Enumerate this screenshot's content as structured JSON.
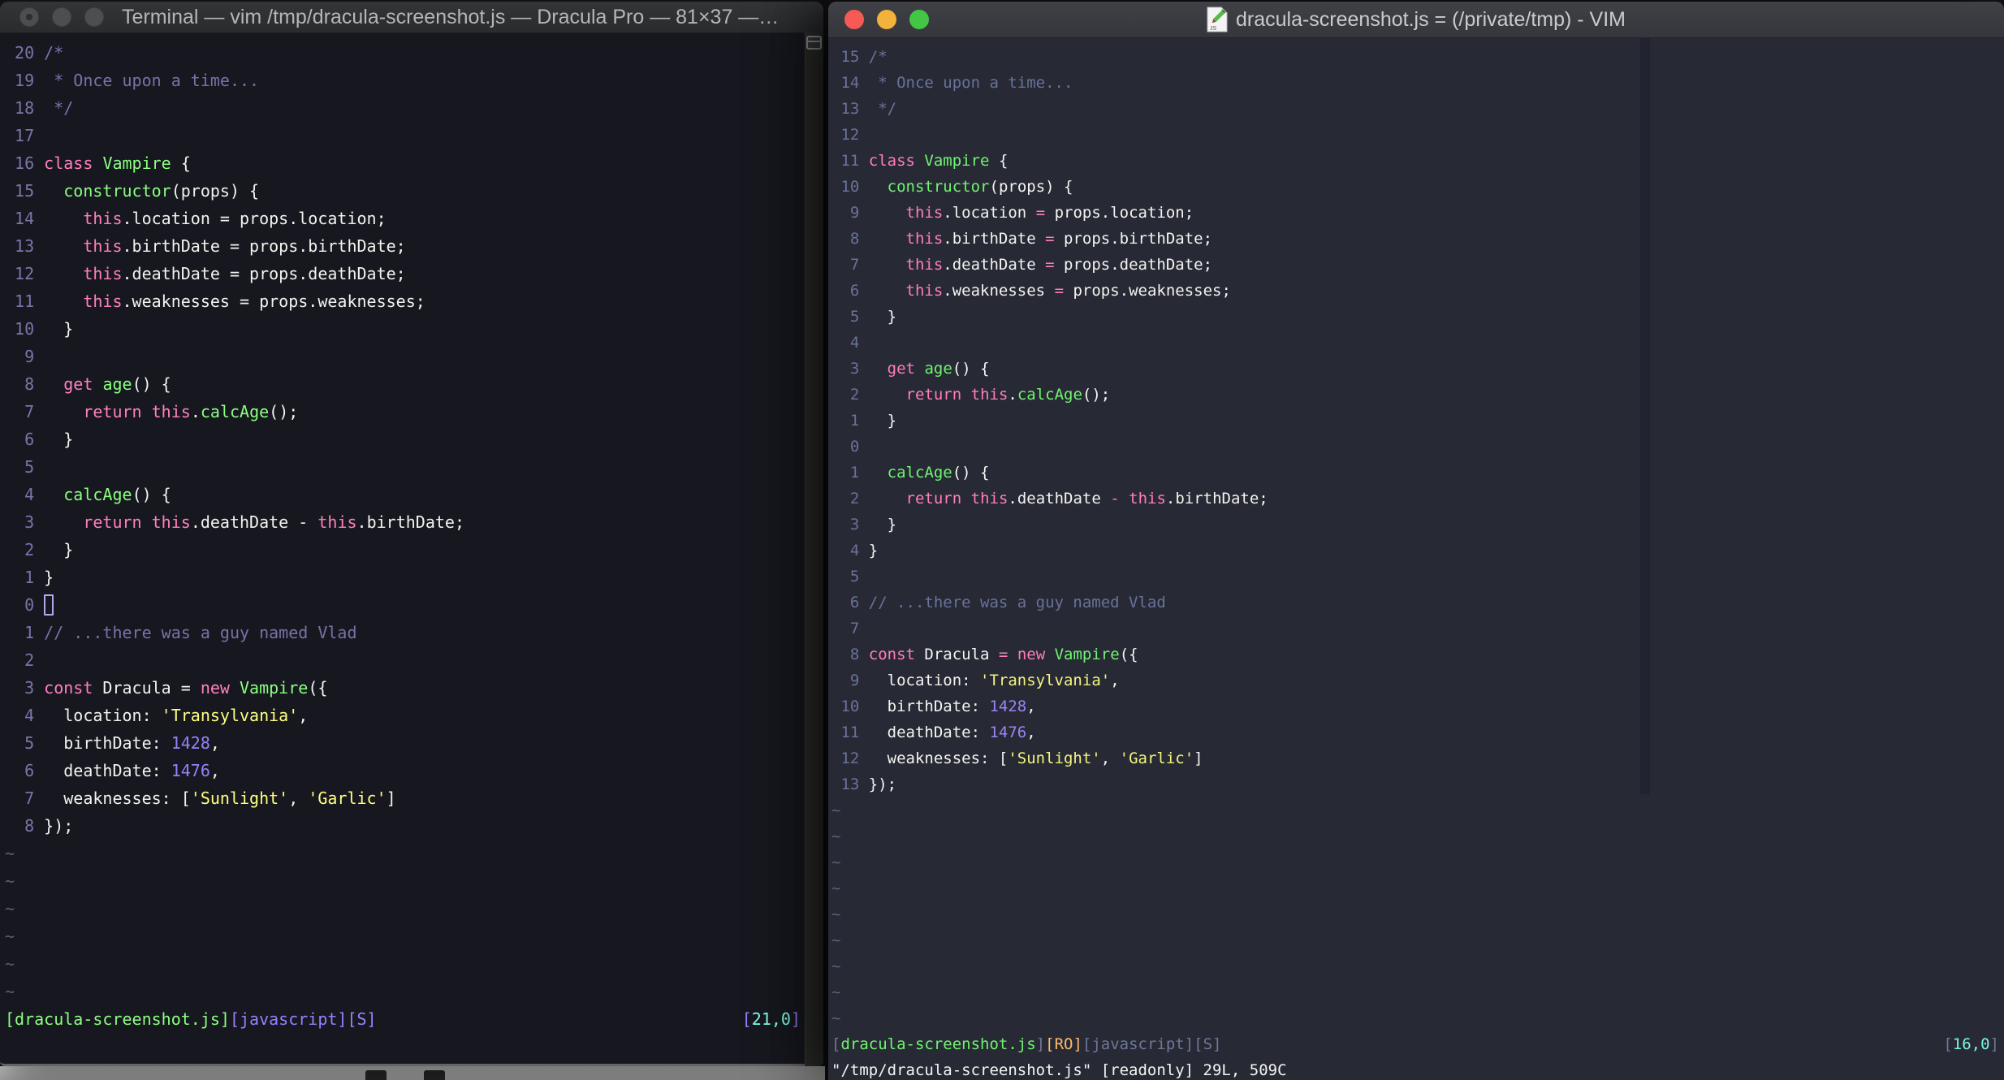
{
  "left_window": {
    "title": "Terminal — vim /tmp/dracula-screenshot.js — Dracula Pro — 81×37 —…",
    "pal": {
      "fg": "#f2f2ef",
      "kw": "#ff80bf",
      "fn": "#8aff80",
      "st": "#ffff80",
      "nu": "#9580ff",
      "cm": "#7970a9",
      "ln": "#7b74ab",
      "ti": "#5a5f6e",
      "cy": "#80ffea",
      "or": "#ffb86c",
      "sb": "#9580ff"
    },
    "lines": [
      {
        "g": " 20",
        "seg": [
          [
            "cm",
            "/*"
          ]
        ]
      },
      {
        "g": " 19",
        "seg": [
          [
            "cm",
            " * Once upon a time..."
          ]
        ]
      },
      {
        "g": " 18",
        "seg": [
          [
            "cm",
            " */"
          ]
        ]
      },
      {
        "g": " 17",
        "seg": []
      },
      {
        "g": " 16",
        "seg": [
          [
            "kw",
            "class"
          ],
          [
            "fg",
            " "
          ],
          [
            "fn",
            "Vampire"
          ],
          [
            "fg",
            " {"
          ]
        ]
      },
      {
        "g": " 15",
        "seg": [
          [
            "fg",
            "  "
          ],
          [
            "fn",
            "constructor"
          ],
          [
            "fg",
            "(props) {"
          ]
        ]
      },
      {
        "g": " 14",
        "seg": [
          [
            "fg",
            "    "
          ],
          [
            "kw",
            "this"
          ],
          [
            "fg",
            ".location = props.location;"
          ]
        ]
      },
      {
        "g": " 13",
        "seg": [
          [
            "fg",
            "    "
          ],
          [
            "kw",
            "this"
          ],
          [
            "fg",
            ".birthDate = props.birthDate;"
          ]
        ]
      },
      {
        "g": " 12",
        "seg": [
          [
            "fg",
            "    "
          ],
          [
            "kw",
            "this"
          ],
          [
            "fg",
            ".deathDate = props.deathDate;"
          ]
        ]
      },
      {
        "g": " 11",
        "seg": [
          [
            "fg",
            "    "
          ],
          [
            "kw",
            "this"
          ],
          [
            "fg",
            ".weaknesses = props.weaknesses;"
          ]
        ]
      },
      {
        "g": " 10",
        "seg": [
          [
            "fg",
            "  }"
          ]
        ]
      },
      {
        "g": "  9",
        "seg": []
      },
      {
        "g": "  8",
        "seg": [
          [
            "fg",
            "  "
          ],
          [
            "kw",
            "get"
          ],
          [
            "fg",
            " "
          ],
          [
            "fn",
            "age"
          ],
          [
            "fg",
            "() {"
          ]
        ]
      },
      {
        "g": "  7",
        "seg": [
          [
            "fg",
            "    "
          ],
          [
            "kw",
            "return"
          ],
          [
            "fg",
            " "
          ],
          [
            "kw",
            "this"
          ],
          [
            "fg",
            "."
          ],
          [
            "fn",
            "calcAge"
          ],
          [
            "fg",
            "();"
          ]
        ]
      },
      {
        "g": "  6",
        "seg": [
          [
            "fg",
            "  }"
          ]
        ]
      },
      {
        "g": "  5",
        "seg": []
      },
      {
        "g": "  4",
        "seg": [
          [
            "fg",
            "  "
          ],
          [
            "fn",
            "calcAge"
          ],
          [
            "fg",
            "() {"
          ]
        ]
      },
      {
        "g": "  3",
        "seg": [
          [
            "fg",
            "    "
          ],
          [
            "kw",
            "return"
          ],
          [
            "fg",
            " "
          ],
          [
            "kw",
            "this"
          ],
          [
            "fg",
            ".deathDate - "
          ],
          [
            "kw",
            "this"
          ],
          [
            "fg",
            ".birthDate;"
          ]
        ]
      },
      {
        "g": "  2",
        "seg": [
          [
            "fg",
            "  }"
          ]
        ]
      },
      {
        "g": "  1",
        "seg": [
          [
            "fg",
            "}"
          ]
        ]
      },
      {
        "g": "  0",
        "seg": [
          [
            "cur",
            ""
          ]
        ]
      },
      {
        "g": "  1",
        "seg": [
          [
            "cm",
            "// ...there was a guy named Vlad"
          ]
        ]
      },
      {
        "g": "  2",
        "seg": []
      },
      {
        "g": "  3",
        "seg": [
          [
            "kw",
            "const"
          ],
          [
            "fg",
            " Dracula = "
          ],
          [
            "kw",
            "new"
          ],
          [
            "fg",
            " "
          ],
          [
            "fn",
            "Vampire"
          ],
          [
            "fg",
            "({"
          ]
        ]
      },
      {
        "g": "  4",
        "seg": [
          [
            "fg",
            "  location: "
          ],
          [
            "st",
            "'Transylvania'"
          ],
          [
            "fg",
            ","
          ]
        ]
      },
      {
        "g": "  5",
        "seg": [
          [
            "fg",
            "  birthDate: "
          ],
          [
            "nu",
            "1428"
          ],
          [
            "fg",
            ","
          ]
        ]
      },
      {
        "g": "  6",
        "seg": [
          [
            "fg",
            "  deathDate: "
          ],
          [
            "nu",
            "1476"
          ],
          [
            "fg",
            ","
          ]
        ]
      },
      {
        "g": "  7",
        "seg": [
          [
            "fg",
            "  weaknesses: ["
          ],
          [
            "st",
            "'Sunlight'"
          ],
          [
            "fg",
            ", "
          ],
          [
            "st",
            "'Garlic'"
          ],
          [
            "fg",
            "]"
          ]
        ]
      },
      {
        "g": "  8",
        "seg": [
          [
            "fg",
            "});"
          ]
        ]
      },
      {
        "g": "",
        "seg": [
          [
            "ti",
            "~"
          ]
        ]
      },
      {
        "g": "",
        "seg": [
          [
            "ti",
            "~"
          ]
        ]
      },
      {
        "g": "",
        "seg": [
          [
            "ti",
            "~"
          ]
        ]
      },
      {
        "g": "",
        "seg": [
          [
            "ti",
            "~"
          ]
        ]
      },
      {
        "g": "",
        "seg": [
          [
            "ti",
            "~"
          ]
        ]
      },
      {
        "g": "",
        "seg": [
          [
            "ti",
            "~"
          ]
        ]
      }
    ],
    "status_left": [
      [
        "fn",
        "[dracula-screenshot.js]"
      ],
      [
        "sb",
        "[javascript][S]"
      ]
    ],
    "status_right": [
      [
        "sb",
        "["
      ],
      [
        "cy",
        "21,0"
      ],
      [
        "sb",
        "]"
      ]
    ],
    "cmdline": ""
  },
  "right_window": {
    "title": "dracula-screenshot.js = (/private/tmp) - VIM",
    "pal": {
      "fg": "#f4f4f1",
      "kw": "#ff7ebc",
      "fn": "#70f470",
      "st": "#f3f47e",
      "nu": "#9a84f5",
      "cm": "#6a7299",
      "ln": "#6a7299",
      "ti": "#5b627a",
      "cy": "#7df3e3",
      "or": "#ffb86c",
      "sb": "#6f7796"
    },
    "lines": [
      {
        "g": " 15",
        "seg": [
          [
            "cm",
            "/*"
          ]
        ]
      },
      {
        "g": " 14",
        "seg": [
          [
            "cm",
            " * Once upon a time..."
          ]
        ]
      },
      {
        "g": " 13",
        "seg": [
          [
            "cm",
            " */"
          ]
        ]
      },
      {
        "g": " 12",
        "seg": []
      },
      {
        "g": " 11",
        "seg": [
          [
            "kw",
            "class"
          ],
          [
            "fg",
            " "
          ],
          [
            "fn",
            "Vampire"
          ],
          [
            "fg",
            " {"
          ]
        ]
      },
      {
        "g": " 10",
        "seg": [
          [
            "fg",
            "  "
          ],
          [
            "fn",
            "constructor"
          ],
          [
            "fg",
            "(props) {"
          ]
        ]
      },
      {
        "g": "  9",
        "seg": [
          [
            "fg",
            "    "
          ],
          [
            "kw",
            "this"
          ],
          [
            "fg",
            ".location "
          ],
          [
            "kw",
            "="
          ],
          [
            "fg",
            " props.location;"
          ]
        ]
      },
      {
        "g": "  8",
        "seg": [
          [
            "fg",
            "    "
          ],
          [
            "kw",
            "this"
          ],
          [
            "fg",
            ".birthDate "
          ],
          [
            "kw",
            "="
          ],
          [
            "fg",
            " props.birthDate;"
          ]
        ]
      },
      {
        "g": "  7",
        "seg": [
          [
            "fg",
            "    "
          ],
          [
            "kw",
            "this"
          ],
          [
            "fg",
            ".deathDate "
          ],
          [
            "kw",
            "="
          ],
          [
            "fg",
            " props.deathDate;"
          ]
        ]
      },
      {
        "g": "  6",
        "seg": [
          [
            "fg",
            "    "
          ],
          [
            "kw",
            "this"
          ],
          [
            "fg",
            ".weaknesses "
          ],
          [
            "kw",
            "="
          ],
          [
            "fg",
            " props.weaknesses;"
          ]
        ]
      },
      {
        "g": "  5",
        "seg": [
          [
            "fg",
            "  }"
          ]
        ]
      },
      {
        "g": "  4",
        "seg": []
      },
      {
        "g": "  3",
        "seg": [
          [
            "fg",
            "  "
          ],
          [
            "kw",
            "get"
          ],
          [
            "fg",
            " "
          ],
          [
            "fn",
            "age"
          ],
          [
            "fg",
            "() {"
          ]
        ]
      },
      {
        "g": "  2",
        "seg": [
          [
            "fg",
            "    "
          ],
          [
            "kw",
            "return"
          ],
          [
            "fg",
            " "
          ],
          [
            "kw",
            "this"
          ],
          [
            "fg",
            "."
          ],
          [
            "fn",
            "calcAge"
          ],
          [
            "fg",
            "();"
          ]
        ]
      },
      {
        "g": "  1",
        "seg": [
          [
            "fg",
            "  }"
          ]
        ]
      },
      {
        "g": "  0",
        "seg": []
      },
      {
        "g": "  1",
        "seg": [
          [
            "fg",
            "  "
          ],
          [
            "fn",
            "calcAge"
          ],
          [
            "fg",
            "() {"
          ]
        ]
      },
      {
        "g": "  2",
        "seg": [
          [
            "fg",
            "    "
          ],
          [
            "kw",
            "return"
          ],
          [
            "fg",
            " "
          ],
          [
            "kw",
            "this"
          ],
          [
            "fg",
            ".deathDate "
          ],
          [
            "kw",
            "-"
          ],
          [
            "fg",
            " "
          ],
          [
            "kw",
            "this"
          ],
          [
            "fg",
            ".birthDate;"
          ]
        ]
      },
      {
        "g": "  3",
        "seg": [
          [
            "fg",
            "  }"
          ]
        ]
      },
      {
        "g": "  4",
        "seg": [
          [
            "fg",
            "}"
          ]
        ]
      },
      {
        "g": "  5",
        "seg": []
      },
      {
        "g": "  6",
        "seg": [
          [
            "cm",
            "// ...there was a guy named Vlad"
          ]
        ]
      },
      {
        "g": "  7",
        "seg": []
      },
      {
        "g": "  8",
        "seg": [
          [
            "kw",
            "const"
          ],
          [
            "fg",
            " Dracula "
          ],
          [
            "kw",
            "="
          ],
          [
            "fg",
            " "
          ],
          [
            "kw",
            "new"
          ],
          [
            "fg",
            " "
          ],
          [
            "fn",
            "Vampire"
          ],
          [
            "fg",
            "({"
          ]
        ]
      },
      {
        "g": "  9",
        "seg": [
          [
            "fg",
            "  location: "
          ],
          [
            "st",
            "'Transylvania'"
          ],
          [
            "fg",
            ","
          ]
        ]
      },
      {
        "g": " 10",
        "seg": [
          [
            "fg",
            "  birthDate: "
          ],
          [
            "nu",
            "1428"
          ],
          [
            "fg",
            ","
          ]
        ]
      },
      {
        "g": " 11",
        "seg": [
          [
            "fg",
            "  deathDate: "
          ],
          [
            "nu",
            "1476"
          ],
          [
            "fg",
            ","
          ]
        ]
      },
      {
        "g": " 12",
        "seg": [
          [
            "fg",
            "  weaknesses: ["
          ],
          [
            "st",
            "'Sunlight'"
          ],
          [
            "fg",
            ", "
          ],
          [
            "st",
            "'Garlic'"
          ],
          [
            "fg",
            "]"
          ]
        ]
      },
      {
        "g": " 13",
        "seg": [
          [
            "fg",
            "});"
          ]
        ]
      },
      {
        "g": "",
        "seg": [
          [
            "ti",
            "~"
          ]
        ]
      },
      {
        "g": "",
        "seg": [
          [
            "ti",
            "~"
          ]
        ]
      },
      {
        "g": "",
        "seg": [
          [
            "ti",
            "~"
          ]
        ]
      },
      {
        "g": "",
        "seg": [
          [
            "ti",
            "~"
          ]
        ]
      },
      {
        "g": "",
        "seg": [
          [
            "ti",
            "~"
          ]
        ]
      },
      {
        "g": "",
        "seg": [
          [
            "ti",
            "~"
          ]
        ]
      },
      {
        "g": "",
        "seg": [
          [
            "ti",
            "~"
          ]
        ]
      },
      {
        "g": "",
        "seg": [
          [
            "ti",
            "~"
          ]
        ]
      },
      {
        "g": "",
        "seg": [
          [
            "ti",
            "~"
          ]
        ]
      }
    ],
    "status_left": [
      [
        "sb",
        "["
      ],
      [
        "fn",
        "dracula-screenshot.js"
      ],
      [
        "sb",
        "]"
      ],
      [
        "or",
        "[RO]"
      ],
      [
        "sb",
        "[javascript][S]"
      ]
    ],
    "status_right": [
      [
        "sb",
        "["
      ],
      [
        "cy",
        "16,0"
      ],
      [
        "sb",
        "]"
      ]
    ],
    "cmdline": "\"/tmp/dracula-screenshot.js\" [readonly] 29L, 509C"
  },
  "traffic_colors": {
    "close": "#f65a54",
    "minimize": "#f2b23c",
    "zoom": "#43c644",
    "inactive": "#4c4e51"
  },
  "accent_colors": {
    "left_bg": "#17181f",
    "right_bg": "#272a35",
    "colorcolumn": "#212330"
  }
}
